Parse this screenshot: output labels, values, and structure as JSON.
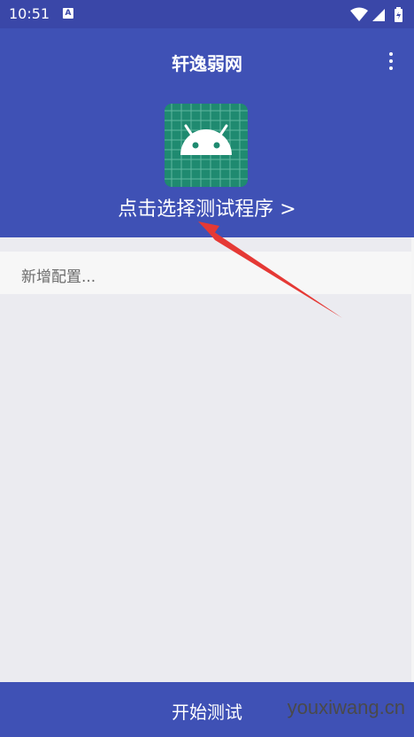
{
  "status": {
    "time": "10:51",
    "notification_letter": "A"
  },
  "header": {
    "title": "轩逸弱网",
    "select_link": "点击选择测试程序 >"
  },
  "config": {
    "add_label": "新增配置..."
  },
  "footer": {
    "start_label": "开始测试"
  },
  "watermark": "youxiwang.cn",
  "colors": {
    "primary": "#3f51b5",
    "status_bar": "#3a47a8",
    "icon_bg": "#1f8a70",
    "arrow": "#e53935"
  },
  "icons": [
    "wifi-icon",
    "signal-icon",
    "battery-icon",
    "more-vert-icon",
    "android-icon"
  ]
}
